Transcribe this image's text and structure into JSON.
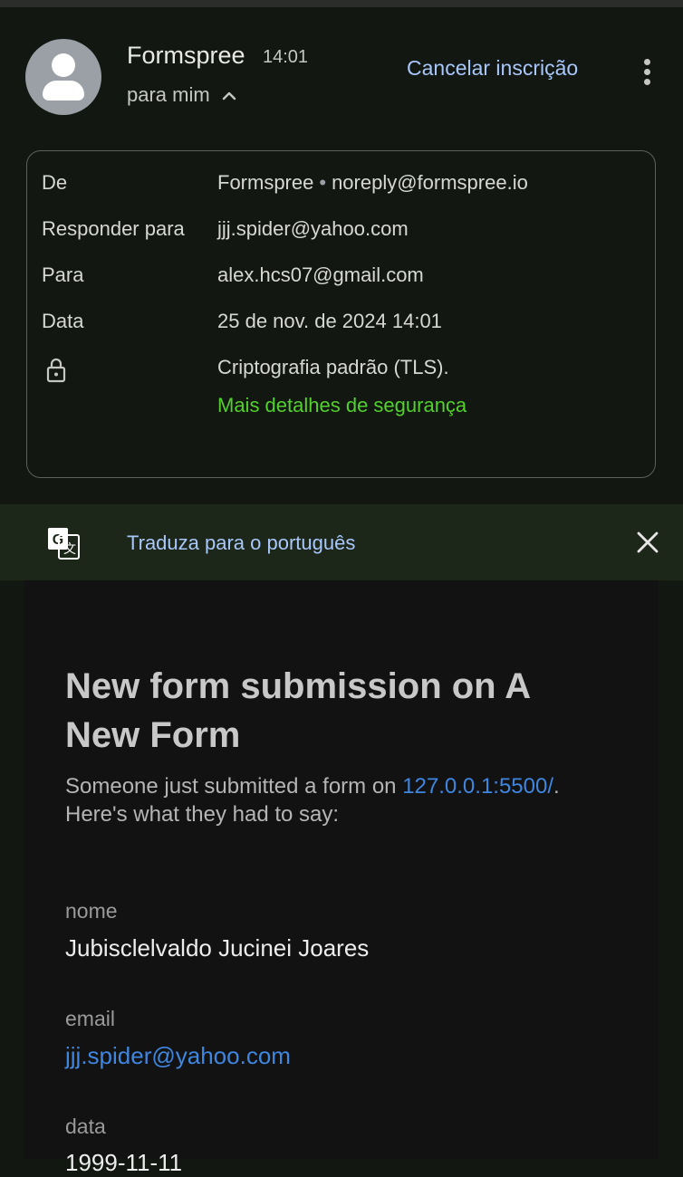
{
  "header": {
    "sender_name": "Formspree",
    "time": "14:01",
    "recipient_summary": "para mim",
    "unsubscribe_label": "Cancelar inscrição"
  },
  "details": {
    "from_label": "De",
    "from_name": "Formspree",
    "from_separator": "•",
    "from_email": "noreply@formspree.io",
    "reply_to_label": "Responder para",
    "reply_to_value": "jjj.spider@yahoo.com",
    "to_label": "Para",
    "to_value": "alex.hcs07@gmail.com",
    "date_label": "Data",
    "date_value": "25 de nov. de 2024 14:01",
    "encryption_value": "Criptografia padrão (TLS).",
    "security_link": "Mais detalhes de segurança"
  },
  "translate": {
    "label": "Traduza para o português"
  },
  "email": {
    "title": "New form submission on A New Form",
    "intro_prefix": "Someone just submitted a form on",
    "intro_link": "127.0.0.1:5500/",
    "intro_suffix": ". Here's what they had to say:",
    "fields": [
      {
        "label": "nome",
        "value": "Jubisclelvaldo Jucinei Joares"
      },
      {
        "label": "email",
        "value": "jjj.spider@yahoo.com"
      },
      {
        "label": "data",
        "value": "1999-11-11"
      }
    ]
  },
  "colors": {
    "background": "#131712",
    "accent_link": "#a8c7fa",
    "security_green": "#52d12c",
    "email_link": "#3f86e0"
  },
  "icons": [
    "avatar-icon",
    "chevron-up-icon",
    "more-vert-icon",
    "lock-icon",
    "translate-icon",
    "close-icon"
  ]
}
